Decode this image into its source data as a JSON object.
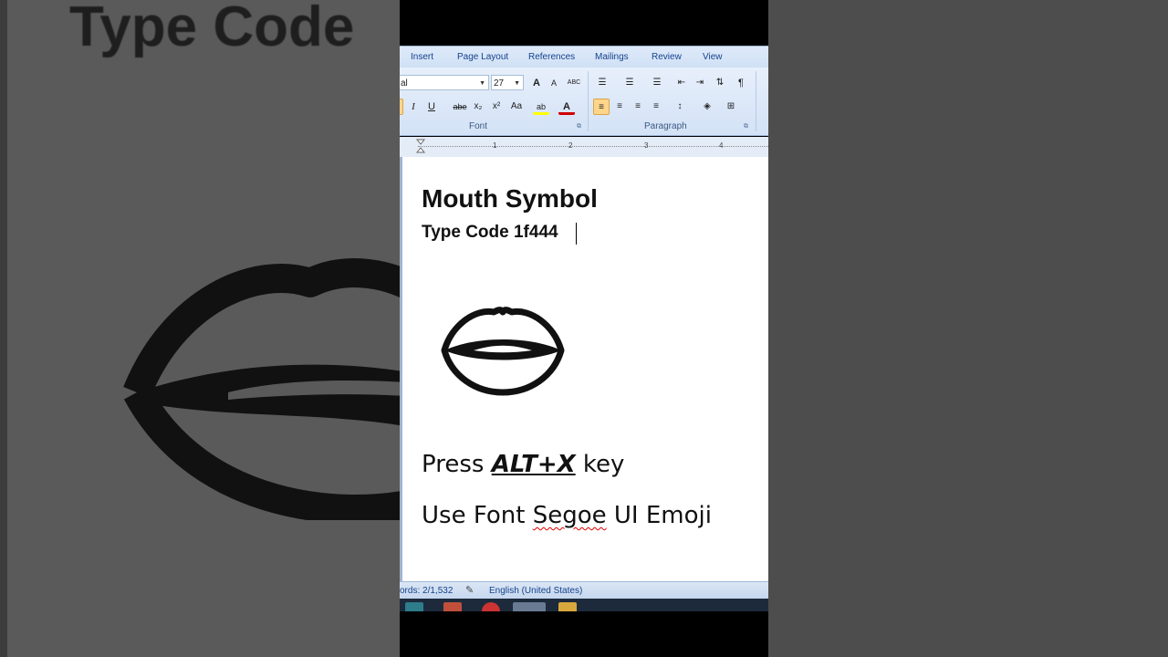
{
  "background": {
    "zoom_text": "Type Code"
  },
  "ribbon": {
    "tabs": [
      "Insert",
      "Page Layout",
      "References",
      "Mailings",
      "Review",
      "View"
    ],
    "font_name": "al",
    "font_size": "27",
    "groups": {
      "font": "Font",
      "paragraph": "Paragraph"
    },
    "buttons": {
      "grow_font": "A",
      "shrink_font": "A",
      "clear_format": "ABC",
      "italic": "I",
      "underline": "U",
      "strikethrough": "abe",
      "subscript": "x₂",
      "superscript": "x²",
      "change_case": "Aa",
      "highlight": "ab",
      "font_color": "A",
      "show_marks": "¶"
    }
  },
  "ruler": {
    "numbers": [
      "1",
      "2",
      "3",
      "4"
    ]
  },
  "document": {
    "heading": "Mouth Symbol",
    "subheading": "Type Code 1f444",
    "press_prefix": "Press ",
    "press_key": "ALT+X",
    "press_suffix": " key",
    "font_prefix": "Use Font ",
    "font_name": "Segoe",
    "font_suffix": " UI Emoji"
  },
  "statusbar": {
    "words": "ords: 2/1,532",
    "language": "English (United States)"
  },
  "colors": {
    "ribbon_text": "#15428b",
    "highlight": "#ffd58a",
    "font_color_red": "#d00000",
    "highlight_yellow": "#ffff00"
  }
}
